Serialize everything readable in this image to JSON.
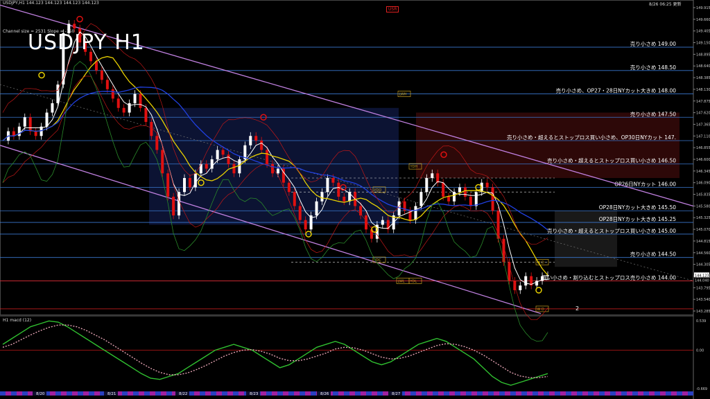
{
  "header": {
    "instrument": "USDJPY,H1  144.123 144.123 144.123 144.123",
    "timestamp": "8/26 06:25 更新",
    "title": "USDJPY H1",
    "channel_info": "Channel size = 2531 Slope = -150",
    "usr_tag": "USR",
    "macd_label": "H1  macd (12)"
  },
  "price_axis": {
    "ticks": [
      "149.915",
      "149.660",
      "149.405",
      "149.150",
      "148.895",
      "148.640",
      "148.385",
      "148.130",
      "147.875",
      "147.620",
      "147.365",
      "147.110",
      "146.855",
      "146.600",
      "146.345",
      "146.090",
      "145.835",
      "145.580",
      "145.325",
      "145.070",
      "144.815",
      "144.560",
      "144.305",
      "144.050",
      "143.795",
      "143.540",
      "143.285"
    ],
    "current": "144.123",
    "current2": "144.040"
  },
  "macd_axis": {
    "ticks": [
      "0.539",
      "0.00",
      "-0.669"
    ]
  },
  "time_axis": {
    "labels": [
      "8/20",
      "8/21",
      "8/22",
      "8/23",
      "8/26",
      "8/27"
    ]
  },
  "levels": [
    {
      "price": 149.0,
      "label": "売り小さめ 149.00"
    },
    {
      "price": 148.5,
      "label": "売り小さめ 148.50"
    },
    {
      "price": 148.0,
      "label": "売り小さめ、OP27・28日NYカット大きめ 148.00"
    },
    {
      "price": 147.5,
      "label": "売り小さめ 147.50"
    },
    {
      "price": 147.0,
      "label": "売り小さめ・超えるとストップロス買い小さめ、OP30日NYカット 147."
    },
    {
      "price": 146.5,
      "label": "売り小さめ・超えるとストップロス買い小さめ 146.50"
    },
    {
      "price": 146.0,
      "label": "OP26日NYカット 146.00"
    },
    {
      "price": 145.5,
      "label": "OP28日NYカット大きめ 145.50"
    },
    {
      "price": 145.25,
      "label": "OP28日NYカット大きめ 145.25"
    },
    {
      "price": 145.0,
      "label": "売り小さめ・超えるとストップロス買い小さめ 145.00"
    },
    {
      "price": 144.5,
      "label": "売り小さめ 144.50"
    },
    {
      "price": 144.0,
      "label": "買い小さめ・割り込むとストップロス売り小さめ 144.00"
    }
  ],
  "boxes": [
    {
      "label": "LWH"
    },
    {
      "label": "YDH"
    },
    {
      "label": "YDO"
    },
    {
      "label": "YDC"
    },
    {
      "label": "LWL"
    },
    {
      "label": "YDL"
    },
    {
      "label": "W D"
    },
    {
      "label": "W D"
    }
  ],
  "markers": {
    "wave_label": "2"
  },
  "chart_data": {
    "type": "line",
    "title": "USDJPY H1",
    "price_range": [
      143.28,
      149.92
    ],
    "macd_range": [
      -0.669,
      0.539
    ],
    "x_count": 140,
    "series": [
      {
        "name": "price_close",
        "values": [
          147.0,
          147.2,
          147.1,
          147.3,
          147.5,
          147.2,
          147.1,
          147.3,
          147.6,
          147.8,
          148.2,
          149.3,
          149.5,
          149.4,
          149.1,
          148.9,
          148.7,
          148.5,
          148.3,
          148.1,
          147.9,
          147.7,
          147.6,
          147.8,
          148.0,
          147.7,
          147.4,
          147.1,
          146.8,
          146.3,
          145.8,
          145.4,
          145.9,
          146.2,
          146.0,
          146.3,
          146.5,
          146.4,
          146.6,
          146.8,
          146.7,
          146.5,
          146.3,
          146.6,
          146.9,
          147.1,
          147.0,
          146.8,
          146.5,
          146.3,
          146.4,
          146.1,
          145.9,
          145.6,
          145.3,
          145.1,
          145.4,
          145.7,
          145.9,
          146.2,
          146.1,
          145.8,
          145.7,
          145.9,
          145.6,
          145.4,
          145.1,
          144.9,
          145.2,
          145.3,
          145.1,
          145.4,
          145.7,
          145.5,
          145.3,
          145.6,
          145.9,
          146.2,
          146.3,
          146.1,
          145.8,
          145.7,
          145.9,
          146.0,
          145.8,
          145.6,
          145.9,
          146.1,
          146.0,
          145.5,
          144.9,
          144.4,
          144.0,
          143.8,
          143.9,
          144.1,
          143.9,
          144.0,
          144.1,
          144.12
        ]
      },
      {
        "name": "macd_main",
        "values": [
          0.1,
          0.2,
          0.3,
          0.4,
          0.45,
          0.5,
          0.48,
          0.4,
          0.3,
          0.2,
          0.1,
          0.0,
          -0.1,
          -0.2,
          -0.3,
          -0.4,
          -0.48,
          -0.5,
          -0.45,
          -0.4,
          -0.3,
          -0.2,
          -0.1,
          0.0,
          0.05,
          0.1,
          0.05,
          0.0,
          -0.1,
          -0.2,
          -0.3,
          -0.25,
          -0.15,
          -0.05,
          0.05,
          0.1,
          0.15,
          0.1,
          0.0,
          -0.1,
          -0.2,
          -0.25,
          -0.2,
          -0.1,
          0.0,
          0.1,
          0.15,
          0.2,
          0.15,
          0.05,
          -0.05,
          -0.15,
          -0.3,
          -0.45,
          -0.55,
          -0.6,
          -0.55,
          -0.5,
          -0.45,
          -0.4
        ]
      },
      {
        "name": "macd_signal",
        "values": [
          0.05,
          0.1,
          0.18,
          0.26,
          0.33,
          0.39,
          0.43,
          0.43,
          0.4,
          0.34,
          0.26,
          0.18,
          0.08,
          -0.02,
          -0.12,
          -0.22,
          -0.31,
          -0.38,
          -0.42,
          -0.42,
          -0.39,
          -0.33,
          -0.26,
          -0.18,
          -0.1,
          -0.04,
          0.0,
          0.01,
          -0.02,
          -0.07,
          -0.14,
          -0.18,
          -0.18,
          -0.15,
          -0.1,
          -0.05,
          0.02,
          0.05,
          0.04,
          0.0,
          -0.06,
          -0.12,
          -0.15,
          -0.14,
          -0.1,
          -0.04,
          0.02,
          0.08,
          0.11,
          0.1,
          0.06,
          0.0,
          -0.08,
          -0.18,
          -0.28,
          -0.38,
          -0.44,
          -0.47,
          -0.47,
          -0.45
        ]
      }
    ]
  }
}
